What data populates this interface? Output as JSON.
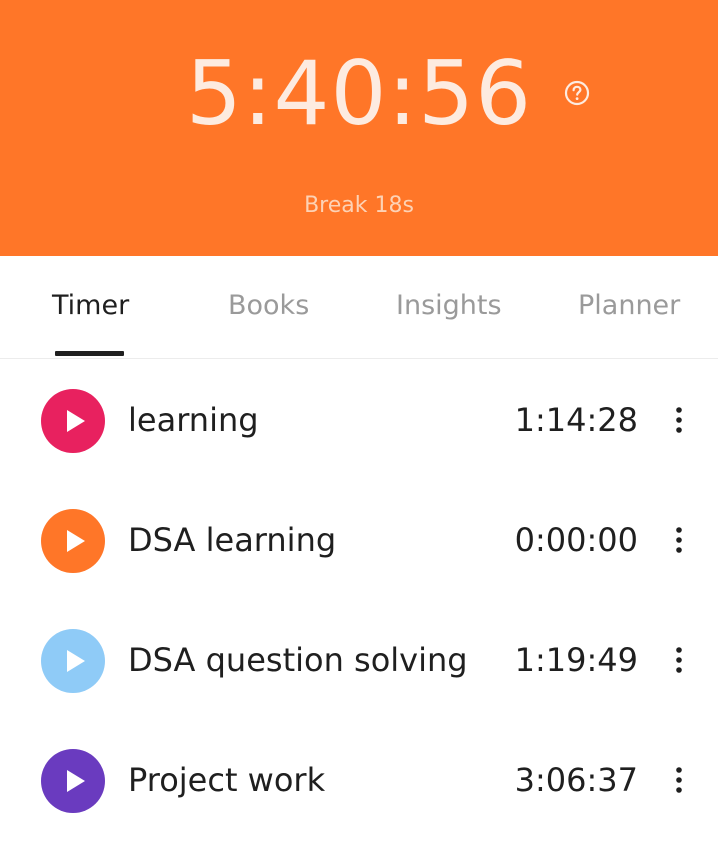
{
  "timer": {
    "display": "5:40:56",
    "break_label": "Break 18s",
    "help_icon": "help-circle-icon",
    "header_color": "#FF7628"
  },
  "tabs": [
    {
      "label": "Timer",
      "active": true
    },
    {
      "label": "Books",
      "active": false
    },
    {
      "label": "Insights",
      "active": false
    },
    {
      "label": "Planner",
      "active": false
    }
  ],
  "tasks": [
    {
      "name": "learning",
      "time": "1:14:28",
      "color": "#E8215F",
      "icon": "play-icon"
    },
    {
      "name": "DSA learning",
      "time": "0:00:00",
      "color": "#FF7628",
      "icon": "play-icon"
    },
    {
      "name": "DSA question solving",
      "time": "1:19:49",
      "color": "#8FCBF7",
      "icon": "play-icon"
    },
    {
      "name": "Project work",
      "time": "3:06:37",
      "color": "#6A3BBF",
      "icon": "play-icon"
    }
  ]
}
